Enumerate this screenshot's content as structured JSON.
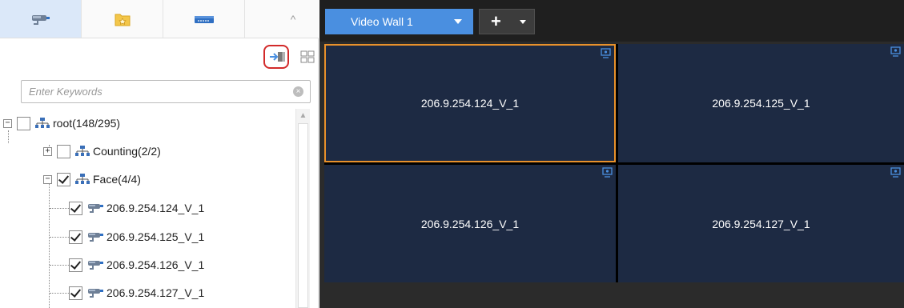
{
  "left_panel": {
    "tabs": [
      {
        "name": "camera-tab",
        "icon": "camera-icon",
        "active": true
      },
      {
        "name": "favorites-tab",
        "icon": "favorites-folder-icon",
        "active": false
      },
      {
        "name": "decoder-tab",
        "icon": "decoder-icon",
        "active": false
      }
    ],
    "collapse_icon": "chevron-up-icon",
    "collapse_glyph": "^",
    "search": {
      "placeholder": "Enter Keywords",
      "value": "",
      "clear_glyph": "×"
    },
    "tree": [
      {
        "label": "root(148/295)",
        "type": "org",
        "checked": false,
        "expander": "−"
      },
      {
        "label": "Counting(2/2)",
        "type": "org",
        "checked": false,
        "expander": "+"
      },
      {
        "label": "Face(4/4)",
        "type": "org",
        "checked": true,
        "expander": "−"
      },
      {
        "label": "206.9.254.124_V_1",
        "type": "camera",
        "checked": true
      },
      {
        "label": "206.9.254.125_V_1",
        "type": "camera",
        "checked": true
      },
      {
        "label": "206.9.254.126_V_1",
        "type": "camera",
        "checked": true
      },
      {
        "label": "206.9.254.127_V_1",
        "type": "camera",
        "checked": true
      }
    ]
  },
  "video_wall": {
    "tab_label": "Video Wall 1",
    "add_glyph": "+",
    "panes": [
      {
        "label": "206.9.254.124_V_1",
        "selected": true
      },
      {
        "label": "206.9.254.125_V_1",
        "selected": false
      },
      {
        "label": "206.9.254.126_V_1",
        "selected": false
      },
      {
        "label": "206.9.254.127_V_1",
        "selected": false
      }
    ]
  },
  "colors": {
    "accent_blue": "#4a8fe0",
    "selection_orange": "#e8912b",
    "pane_background": "#1d2a43",
    "highlight_red": "#d22a2a"
  }
}
